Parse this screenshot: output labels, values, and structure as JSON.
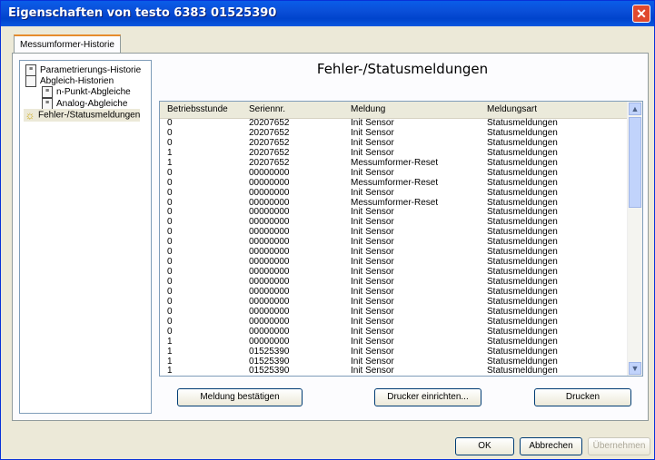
{
  "window": {
    "title": "Eigenschaften von testo 6383  01525390",
    "close_glyph": "✕"
  },
  "tab": {
    "label": "Messumformer-Historie"
  },
  "tree": [
    {
      "label": "Parametrierungs-Historie",
      "icon": "document-icon"
    },
    {
      "label": "Abgleich-Historien",
      "icon": "folder-icon"
    },
    {
      "label": "n-Punkt-Abgleiche",
      "icon": "document-icon"
    },
    {
      "label": "Analog-Abgleiche",
      "icon": "document-icon"
    },
    {
      "label": "Fehler-/Statusmeldungen",
      "icon": "warning-icon"
    }
  ],
  "heading": "Fehler-/Statusmeldungen",
  "table": {
    "columns": [
      "Betriebsstunde",
      "Seriennr.",
      "Meldung",
      "Meldungsart"
    ],
    "rows": [
      [
        "0",
        "20207652",
        "Init Sensor",
        "Statusmeldungen"
      ],
      [
        "0",
        "20207652",
        "Init Sensor",
        "Statusmeldungen"
      ],
      [
        "0",
        "20207652",
        "Init Sensor",
        "Statusmeldungen"
      ],
      [
        "1",
        "20207652",
        "Init Sensor",
        "Statusmeldungen"
      ],
      [
        "1",
        "20207652",
        "Messumformer-Reset",
        "Statusmeldungen"
      ],
      [
        "0",
        "00000000",
        "Init Sensor",
        "Statusmeldungen"
      ],
      [
        "0",
        "00000000",
        "Messumformer-Reset",
        "Statusmeldungen"
      ],
      [
        "0",
        "00000000",
        "Init Sensor",
        "Statusmeldungen"
      ],
      [
        "0",
        "00000000",
        "Messumformer-Reset",
        "Statusmeldungen"
      ],
      [
        "0",
        "00000000",
        "Init Sensor",
        "Statusmeldungen"
      ],
      [
        "0",
        "00000000",
        "Init Sensor",
        "Statusmeldungen"
      ],
      [
        "0",
        "00000000",
        "Init Sensor",
        "Statusmeldungen"
      ],
      [
        "0",
        "00000000",
        "Init Sensor",
        "Statusmeldungen"
      ],
      [
        "0",
        "00000000",
        "Init Sensor",
        "Statusmeldungen"
      ],
      [
        "0",
        "00000000",
        "Init Sensor",
        "Statusmeldungen"
      ],
      [
        "0",
        "00000000",
        "Init Sensor",
        "Statusmeldungen"
      ],
      [
        "0",
        "00000000",
        "Init Sensor",
        "Statusmeldungen"
      ],
      [
        "0",
        "00000000",
        "Init Sensor",
        "Statusmeldungen"
      ],
      [
        "0",
        "00000000",
        "Init Sensor",
        "Statusmeldungen"
      ],
      [
        "0",
        "00000000",
        "Init Sensor",
        "Statusmeldungen"
      ],
      [
        "0",
        "00000000",
        "Init Sensor",
        "Statusmeldungen"
      ],
      [
        "0",
        "00000000",
        "Init Sensor",
        "Statusmeldungen"
      ],
      [
        "1",
        "00000000",
        "Init Sensor",
        "Statusmeldungen"
      ],
      [
        "1",
        "01525390",
        "Init Sensor",
        "Statusmeldungen"
      ],
      [
        "1",
        "01525390",
        "Init Sensor",
        "Statusmeldungen"
      ],
      [
        "1",
        "01525390",
        "Init Sensor",
        "Statusmeldungen"
      ]
    ]
  },
  "scrollbar": {
    "up": "▲",
    "down": "▼"
  },
  "buttons": {
    "confirm": "Meldung bestätigen",
    "printer_setup": "Drucker einrichten...",
    "print": "Drucken",
    "ok": "OK",
    "cancel": "Abbrechen",
    "apply": "Übernehmen"
  }
}
